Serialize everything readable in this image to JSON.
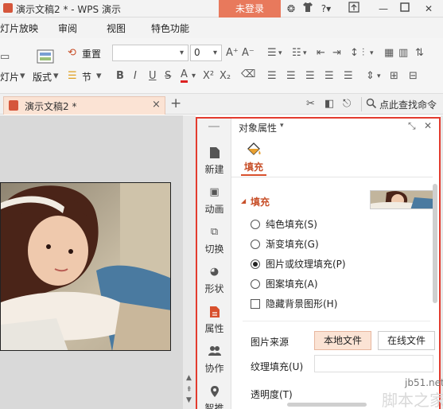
{
  "window": {
    "title": "演示文稿2 * - WPS 演示",
    "login_label": "未登录",
    "question_label": "?"
  },
  "menu": [
    "灯片放映",
    "审阅",
    "视图",
    "特色功能"
  ],
  "ribbon": {
    "reset_label": "重置",
    "new_slide_label": "灯片",
    "layout_label": "版式",
    "section_label": "节",
    "font_size_value": "0",
    "font_styles": [
      "B",
      "I",
      "U",
      "S",
      "A",
      "X²",
      "X₂"
    ]
  },
  "tabs": {
    "doc_tab_label": "演示文稿2 *",
    "close_glyph": "×",
    "add_glyph": "+",
    "search_label": "点此查找命令"
  },
  "side_tabs": [
    "新建",
    "动画",
    "切换",
    "形状",
    "属性",
    "协作",
    "智推"
  ],
  "panel": {
    "title": "对象属性",
    "fill_tab_label": "填充",
    "section_title": "填充",
    "options": [
      {
        "label": "纯色填充(S)",
        "type": "radio",
        "selected": false
      },
      {
        "label": "渐变填充(G)",
        "type": "radio",
        "selected": false
      },
      {
        "label": "图片或纹理填充(P)",
        "type": "radio",
        "selected": true
      },
      {
        "label": "图案填充(A)",
        "type": "radio",
        "selected": false
      },
      {
        "label": "隐藏背景图形(H)",
        "type": "checkbox",
        "selected": false
      }
    ],
    "source_label": "图片来源",
    "local_file_label": "本地文件",
    "online_file_label": "在线文件",
    "texture_label": "纹理填充(U)",
    "transparency_label": "透明度(T)"
  },
  "watermark": {
    "site": "jb51.net",
    "brand": "脚本之家"
  },
  "colors": {
    "accent": "#e33b2e",
    "login_bg": "#e8795c",
    "section_title": "#c8502a",
    "selected_button_bg": "#fbe3d4"
  }
}
